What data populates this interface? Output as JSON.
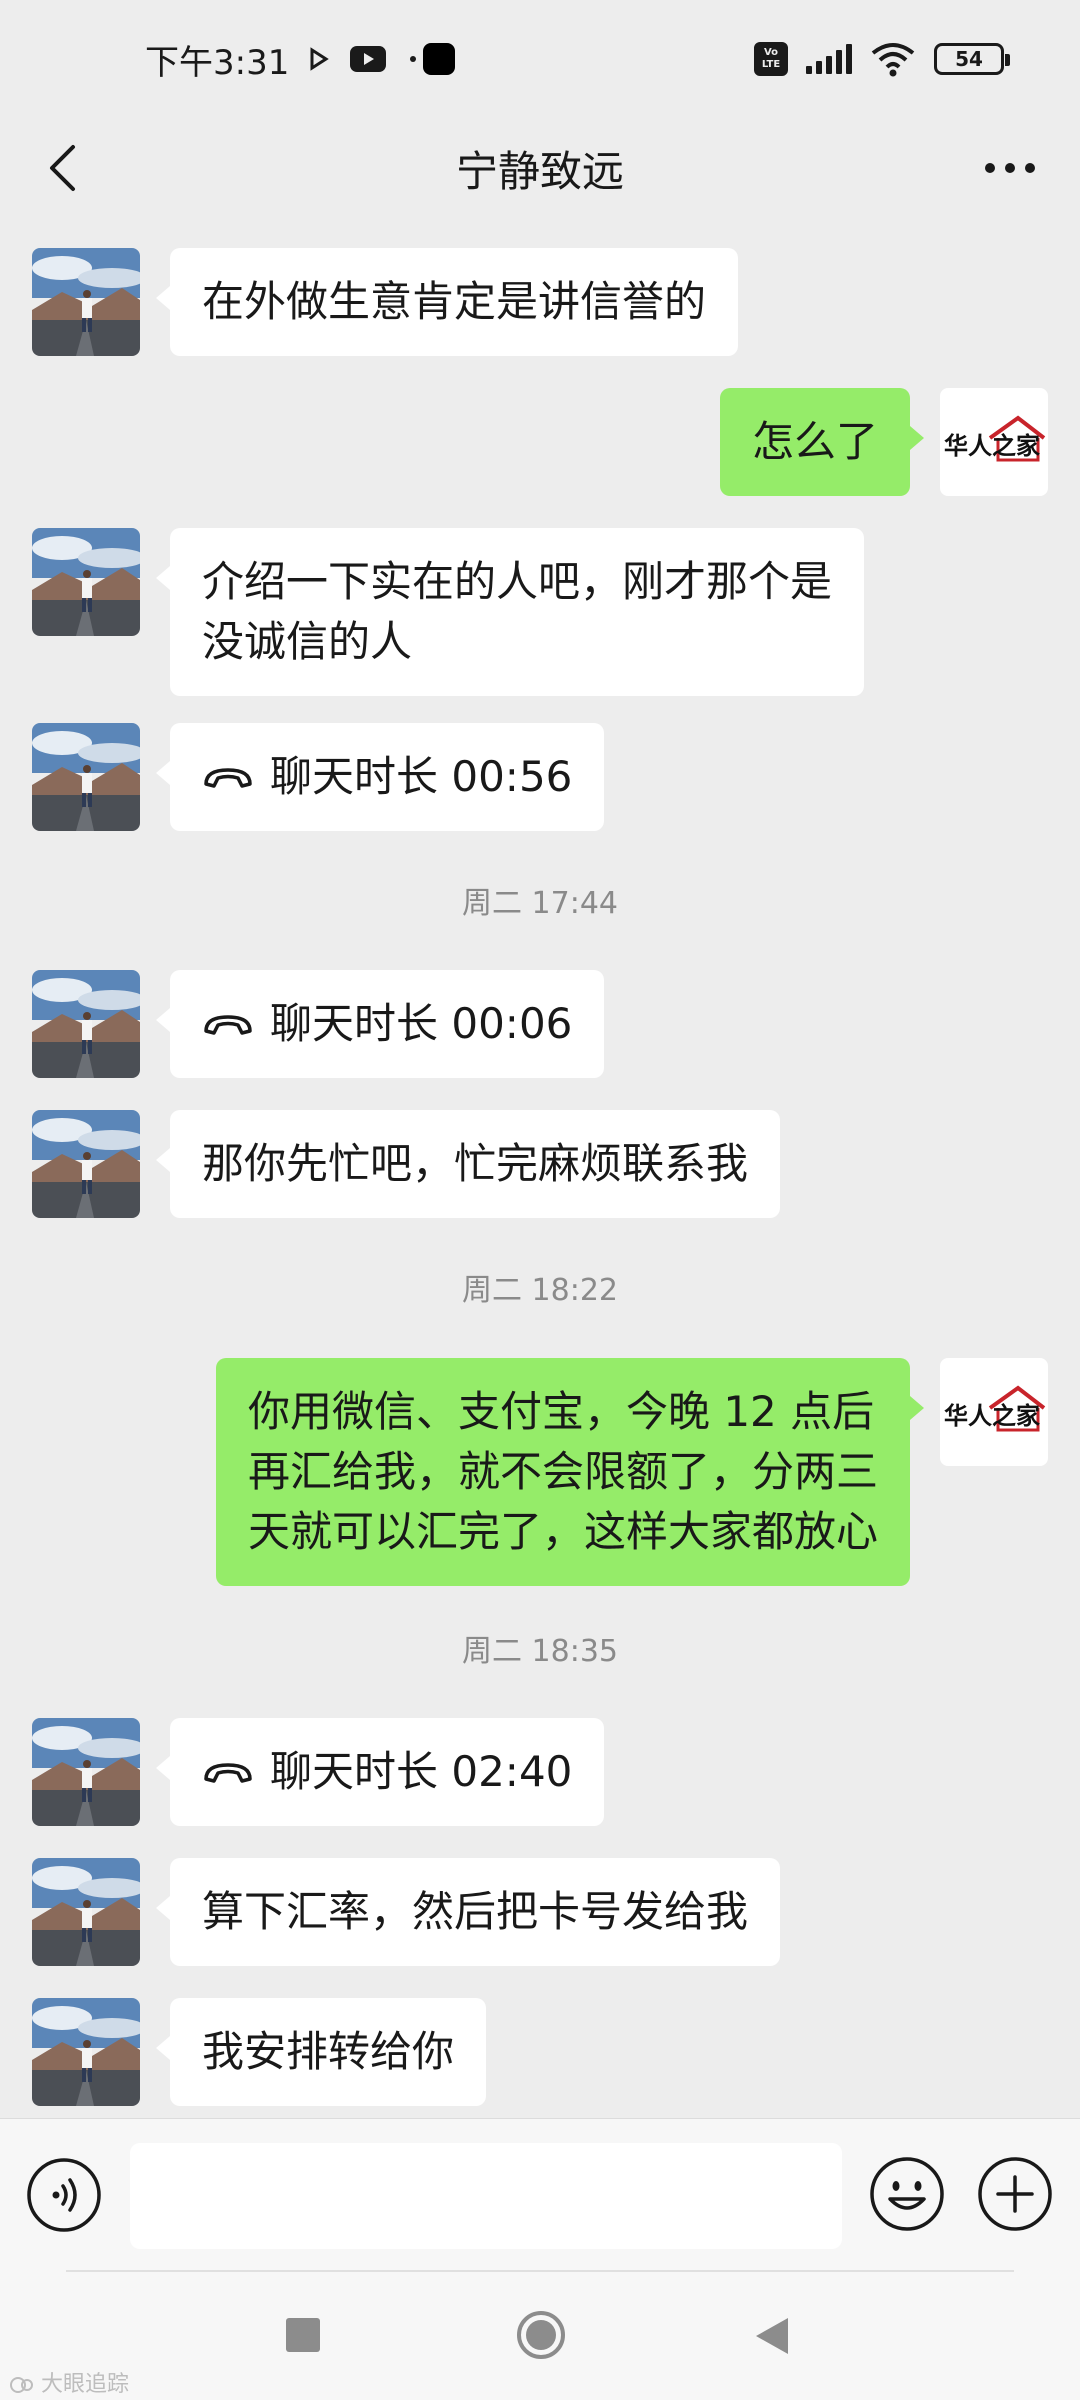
{
  "status_bar": {
    "time": "下午3:31",
    "volte": "Vo LTE",
    "battery": "54"
  },
  "header": {
    "title": "宁静致远",
    "back_icon": "chevron-left-icon",
    "more_icon": "more-dots-icon"
  },
  "messages": [
    {
      "side": "left",
      "type": "text",
      "text": "在外做生意肯定是讲信誉的"
    },
    {
      "side": "right",
      "type": "text",
      "text": "怎么了"
    },
    {
      "side": "left",
      "type": "text",
      "text": "介绍一下实在的人吧，刚才那个是\n没诚信的人"
    },
    {
      "side": "left",
      "type": "call",
      "text": "聊天时长 00:56"
    },
    {
      "type": "time",
      "text": "周二 17:44"
    },
    {
      "side": "left",
      "type": "call",
      "text": "聊天时长 00:06"
    },
    {
      "side": "left",
      "type": "text",
      "text": "那你先忙吧，忙完麻烦联系我"
    },
    {
      "type": "time",
      "text": "周二 18:22"
    },
    {
      "side": "right",
      "type": "text",
      "text": "你用微信、支付宝，今晚 12 点后\n再汇给我，就不会限额了，分两三\n天就可以汇完了，这样大家都放心"
    },
    {
      "type": "time",
      "text": "周二 18:35"
    },
    {
      "side": "left",
      "type": "call",
      "text": "聊天时长 02:40"
    },
    {
      "side": "left",
      "type": "text",
      "text": "算下汇率，然后把卡号发给我"
    },
    {
      "side": "left",
      "type": "text",
      "text": "我安排转给你"
    }
  ],
  "avatar_right_logo": "华人之家",
  "input_bar": {
    "voice_icon": "voice-icon",
    "emoji_icon": "emoji-icon",
    "plus_icon": "plus-icon",
    "input_value": ""
  },
  "watermark": "大眼追踪",
  "colors": {
    "background": "#ededed",
    "bubble_self": "#95ec69",
    "bubble_other": "#ffffff",
    "timestamp": "#8a8a8a"
  }
}
